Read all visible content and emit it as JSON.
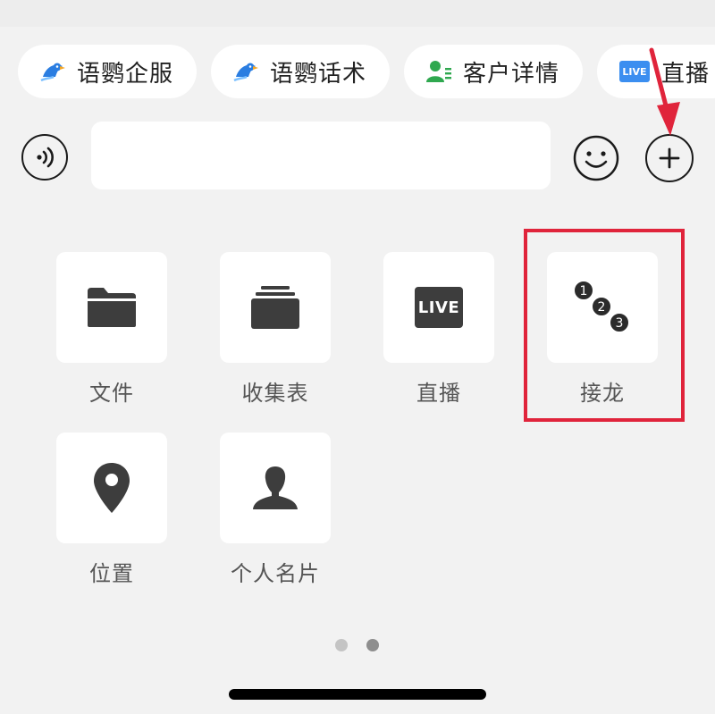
{
  "chips": [
    {
      "label": "语鹦企服",
      "icon": "parrot-icon",
      "color": "#2a7de1"
    },
    {
      "label": "语鹦话术",
      "icon": "parrot-icon",
      "color": "#2a7de1"
    },
    {
      "label": "客户详情",
      "icon": "customer-card-icon",
      "color": "#2fa84f"
    },
    {
      "label": "直播",
      "icon": "live-icon",
      "color": "#3b8ef0",
      "badge": "LIVE"
    }
  ],
  "input": {
    "value": "",
    "placeholder": ""
  },
  "grid": [
    {
      "label": "文件",
      "icon": "folder-icon"
    },
    {
      "label": "收集表",
      "icon": "collection-form-icon"
    },
    {
      "label": "直播",
      "icon": "live-icon",
      "badge": "LIVE"
    },
    {
      "label": "接龙",
      "icon": "chain-sequence-icon",
      "numbers": [
        "1",
        "2",
        "3"
      ]
    },
    {
      "label": "位置",
      "icon": "location-pin-icon"
    },
    {
      "label": "个人名片",
      "icon": "person-card-icon"
    }
  ],
  "pager": {
    "pages": 2,
    "current": 2
  },
  "colors": {
    "background": "#f2f2f2",
    "tile": "#ffffff",
    "icon": "#3d3d3d",
    "highlight": "#e0243b"
  }
}
